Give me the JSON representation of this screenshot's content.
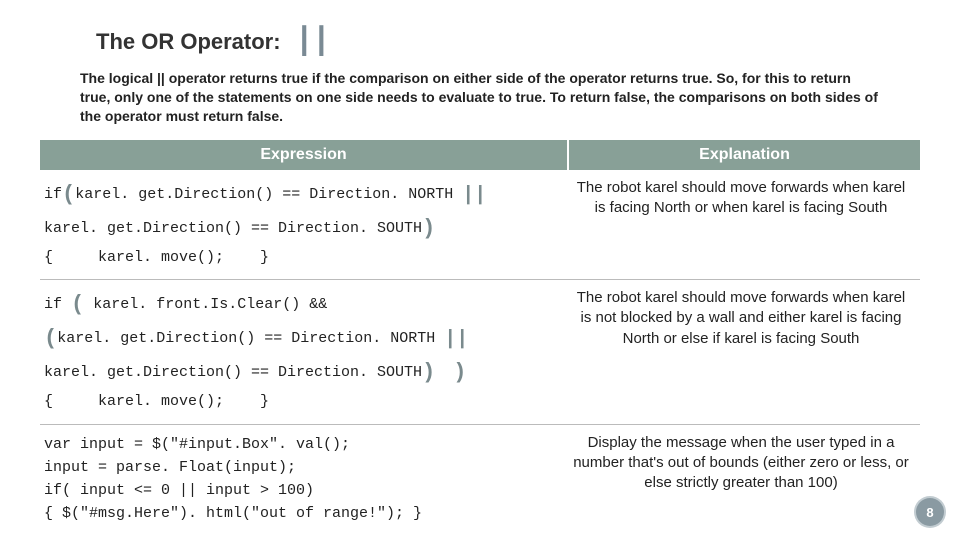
{
  "title": "The OR Operator:",
  "or_symbol": "||",
  "intro": "The logical || operator returns true if the comparison on either side of the operator returns true. So, for this to return true, only one of the statements on one side needs to evaluate to true. To return false, the comparisons on both sides of the operator must return false.",
  "headers": {
    "col1": "Expression",
    "col2": "Explanation"
  },
  "rows": [
    {
      "code": {
        "p1": "if",
        "lp1": "(",
        "p2": "karel. get.Direction() == Direction. NORTH ",
        "or1": "||",
        "p3": "karel. get.Direction() == Direction. SOUTH",
        "rp1": ")",
        "p4": "{     karel. move();    }"
      },
      "expl": "The robot karel should move forwards when karel is facing North or when karel is facing South"
    },
    {
      "code": {
        "p1": "if ",
        "lp1": "(",
        "p2": " karel. front.Is.Clear() &&",
        "lp2": "(",
        "p3": "karel. get.Direction() == Direction. NORTH ",
        "or1": "||",
        "p4": "karel. get.Direction() == Direction. SOUTH",
        "rp1": ")",
        "sp": "  ",
        "rp2": ")",
        "p5": "{     karel. move();    }"
      },
      "expl": "The robot karel should move forwards when karel is not blocked by a wall and either karel is facing North or else if karel is facing South"
    },
    {
      "code": {
        "full": "var input = $(\"#input.Box\". val();\ninput = parse. Float(input);\nif( input <= 0 || input > 100)\n{ $(\"#msg.Here\"). html(\"out of range!\"); }"
      },
      "expl": "Display the message when the user typed in a number that's out of bounds (either zero or less, or else strictly greater than 100)"
    }
  ],
  "page_number": "8"
}
